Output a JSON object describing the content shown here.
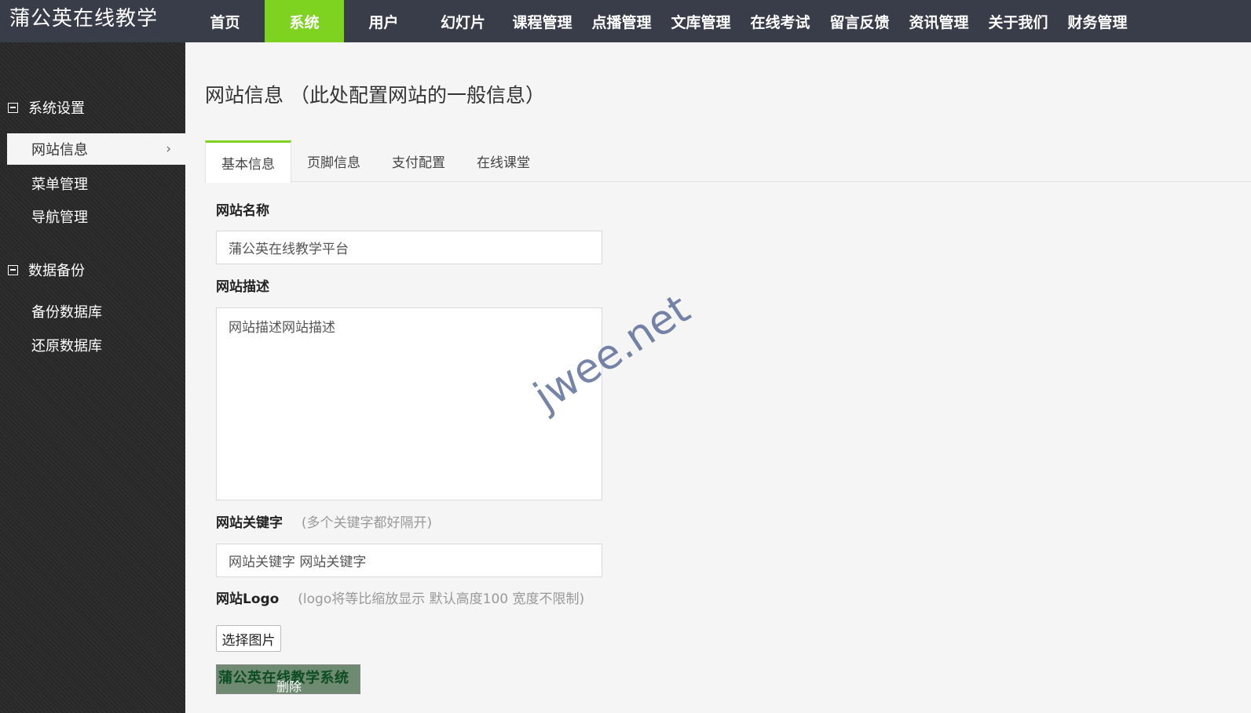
{
  "app": {
    "logo": "蒲公英在线教学"
  },
  "topnav": {
    "items": [
      {
        "label": "首页",
        "active": false
      },
      {
        "label": "系统",
        "active": true
      },
      {
        "label": "用户",
        "active": false
      },
      {
        "label": "幻灯片",
        "active": false
      },
      {
        "label": "课程管理",
        "active": false
      },
      {
        "label": "点播管理",
        "active": false
      },
      {
        "label": "文库管理",
        "active": false
      },
      {
        "label": "在线考试",
        "active": false
      },
      {
        "label": "留言反馈",
        "active": false
      },
      {
        "label": "资讯管理",
        "active": false
      },
      {
        "label": "关于我们",
        "active": false
      },
      {
        "label": "财务管理",
        "active": false
      }
    ]
  },
  "sidebar": {
    "groups": [
      {
        "title": "系统设置",
        "items": [
          "网站信息",
          "菜单管理",
          "导航管理"
        ]
      },
      {
        "title": "数据备份",
        "items": [
          "备份数据库",
          "还原数据库"
        ]
      }
    ]
  },
  "main": {
    "title": "网站信息 （此处配置网站的一般信息）",
    "tabs": [
      "基本信息",
      "页脚信息",
      "支付配置",
      "在线课堂"
    ],
    "fields": {
      "site_name": {
        "label": "网站名称",
        "value": "蒲公英在线教学平台"
      },
      "site_desc": {
        "label": "网站描述",
        "value": "网站描述网站描述"
      },
      "site_keywords": {
        "label": "网站关键字",
        "hint": "(多个关键字都好隔开)",
        "value": "网站关键字 网站关键字"
      },
      "site_logo": {
        "label": "网站Logo",
        "hint": "(logo将等比缩放显示 默认高度100 宽度不限制)",
        "choose_label": "选择图片",
        "preview_text": "蒲公英在线教学系统",
        "delete_label": "删除"
      }
    }
  },
  "watermark": "jwee.net",
  "colors": {
    "topbar": "#393d49",
    "accent": "#7ed321",
    "sidebar": "#2a2a2a"
  }
}
